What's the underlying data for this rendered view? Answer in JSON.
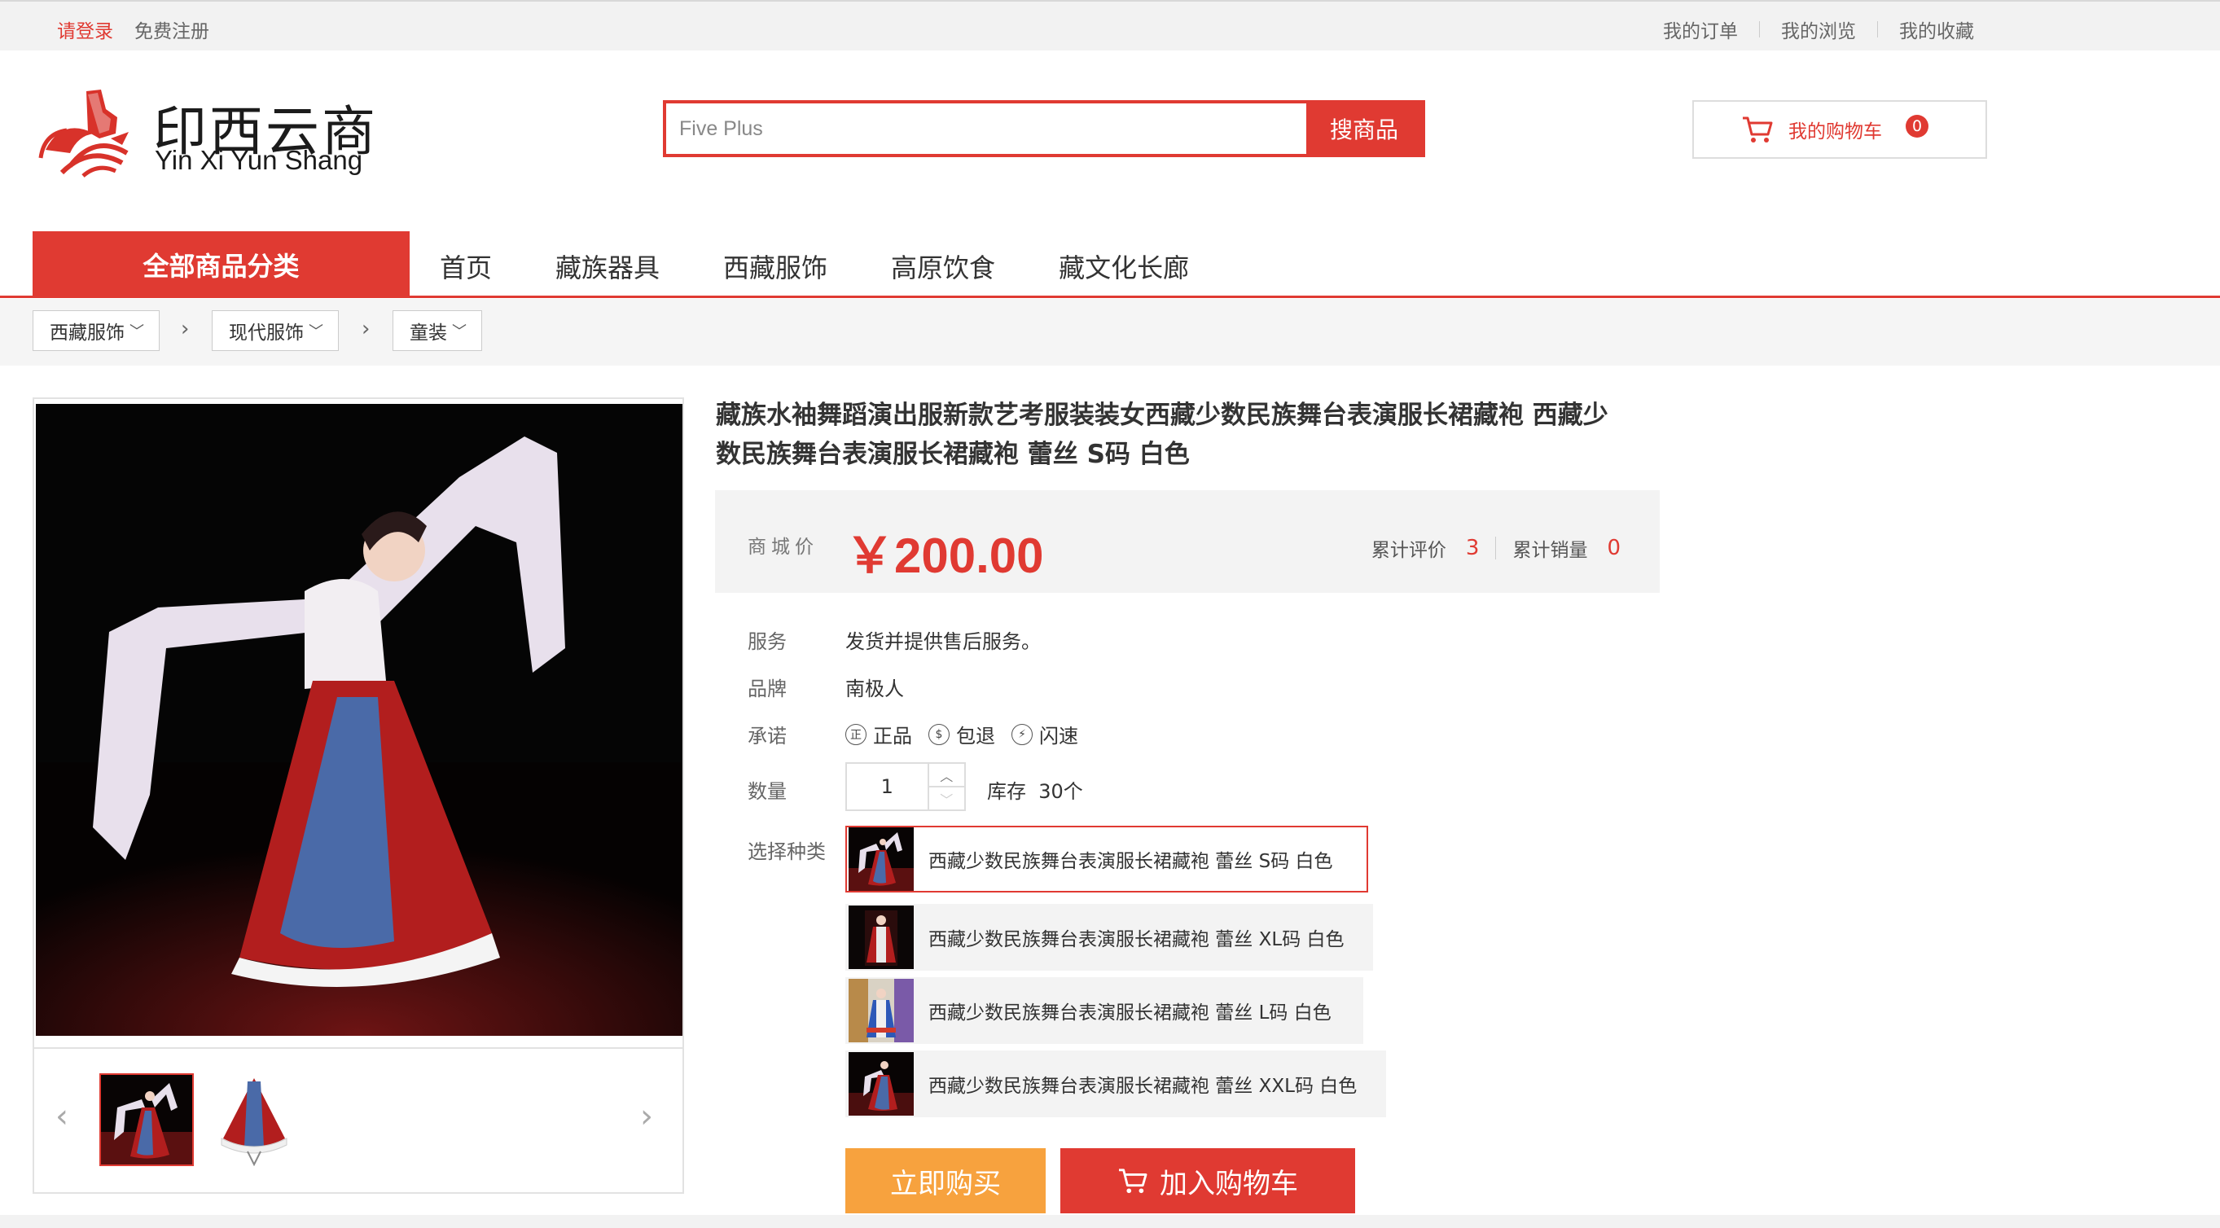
{
  "topbar": {
    "login": "请登录",
    "register": "免费注册",
    "links": [
      "我的订单",
      "我的浏览",
      "我的收藏"
    ]
  },
  "logo": {
    "zh": "印西云商",
    "en": "Yin Xi Yun Shang"
  },
  "search": {
    "value": "Five Plus",
    "button": "搜商品"
  },
  "cart": {
    "label": "我的购物车",
    "count": "0"
  },
  "nav": {
    "all_categories": "全部商品分类",
    "items": [
      "首页",
      "藏族器具",
      "西藏服饰",
      "高原饮食",
      "藏文化长廊"
    ]
  },
  "breadcrumb": [
    "西藏服饰",
    "现代服饰",
    "童装"
  ],
  "product": {
    "title_line1": "藏族水袖舞蹈演出服新款艺考服装装女西藏少数民族舞台表演服长裙藏袍 西藏少",
    "title_line2": "数民族舞台表演服长裙藏袍 蕾丝 S码 白色",
    "price_label": "商城价",
    "price": "￥200.00",
    "review_label": "累计评价",
    "review_count": "3",
    "sales_label": "累计销量",
    "sales_count": "0",
    "service_label": "服务",
    "service_value": "发货并提供售后服务。",
    "brand_label": "品牌",
    "brand_value": "南极人",
    "promise_label": "承诺",
    "promises": [
      {
        "icon": "genuine-icon",
        "glyph": "正",
        "text": "正品"
      },
      {
        "icon": "refund-icon",
        "glyph": "$",
        "text": "包退"
      },
      {
        "icon": "lightning-icon",
        "glyph": "⚡",
        "text": "闪速"
      }
    ],
    "qty_label": "数量",
    "qty_value": "1",
    "stock_label": "库存",
    "stock_value": "30个",
    "variant_label": "选择种类",
    "variants": [
      "西藏少数民族舞台表演服长裙藏袍 蕾丝 S码 白色",
      "西藏少数民族舞台表演服长裙藏袍 蕾丝 XL码 白色",
      "西藏少数民族舞台表演服长裙藏袍 蕾丝 L码 白色",
      "西藏少数民族舞台表演服长裙藏袍 蕾丝 XXL码 白色"
    ],
    "buy_now": "立即购买",
    "add_cart": "加入购物车"
  },
  "colors": {
    "accent": "#e03a32",
    "buy": "#f7a23e"
  }
}
